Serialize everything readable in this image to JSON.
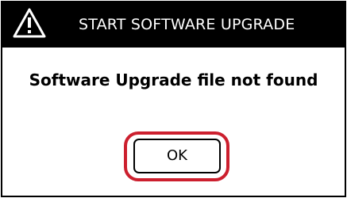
{
  "dialog": {
    "title": "START SOFTWARE UPGRADE",
    "title_icon": "warning-triangle-icon",
    "message": "Software Upgrade file not found",
    "ok_label": "OK"
  },
  "colors": {
    "titlebar_bg": "#000000",
    "titlebar_text": "#ffffff",
    "highlight": "#cc1f2e"
  }
}
